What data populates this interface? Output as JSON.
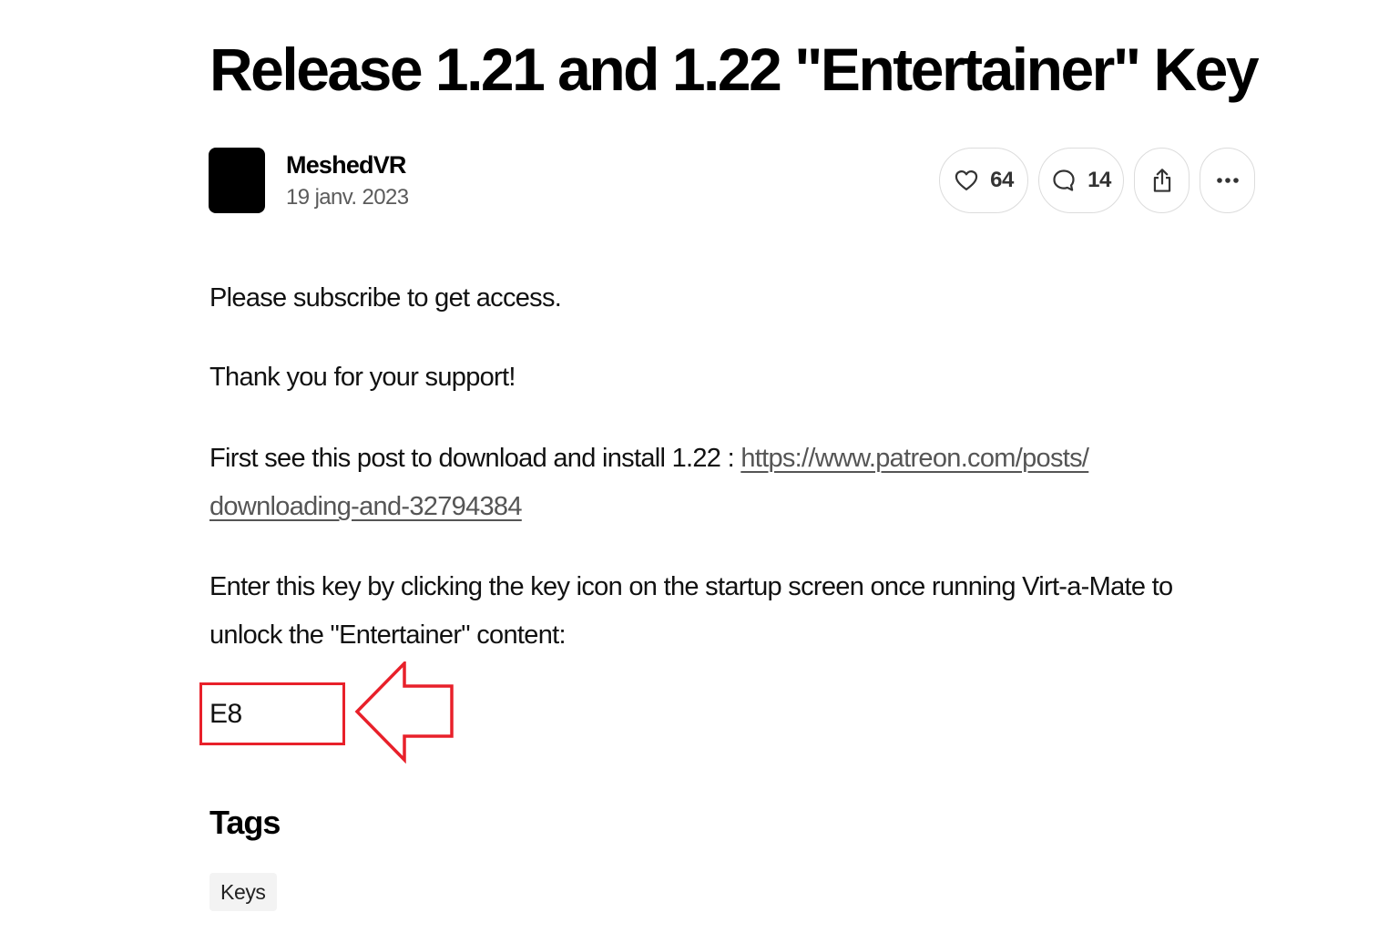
{
  "post": {
    "title": "Release 1.21 and 1.22 \"Entertainer\" Key",
    "author": "MeshedVR",
    "date": "19 janv. 2023"
  },
  "actions": {
    "likes": "64",
    "comments": "14",
    "like_icon": "heart-icon",
    "comment_icon": "comment-bubble-icon",
    "share_icon": "share-icon",
    "more_icon": "more-dots-icon"
  },
  "body": {
    "subscribe_text": "Please subscribe to get access.",
    "thanks_text": "Thank you for your support!",
    "download_text": "First see this post to download and install 1.22 : ",
    "download_link_line1": "https://www.patreon.com/posts/",
    "download_link_line2": "downloading-and-32794384",
    "instructions_line1": "Enter this key by clicking the key icon on the startup screen once running Virt-a-Mate to",
    "instructions_line2": "unlock the \"Entertainer\" content:",
    "key": "E8"
  },
  "annotation": {
    "color": "#e8202a",
    "arrow_icon": "left-arrow-annotation"
  },
  "tags": {
    "heading": "Tags",
    "items": [
      "Keys"
    ]
  }
}
